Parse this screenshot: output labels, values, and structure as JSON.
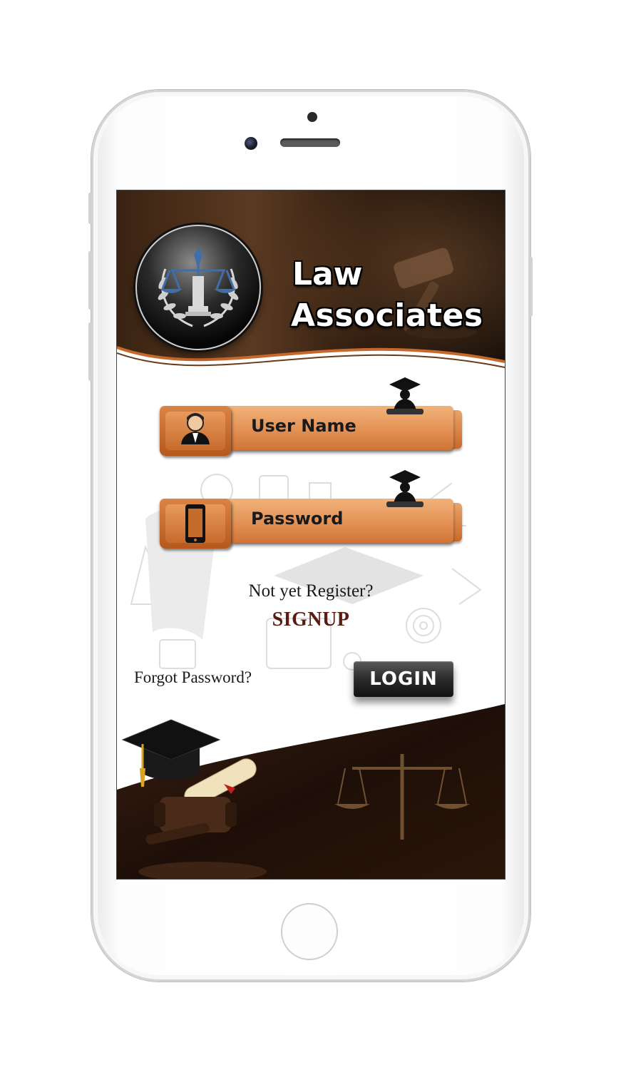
{
  "app": {
    "brand_line1": "Law",
    "brand_line2": "Associates"
  },
  "form": {
    "username_label": "User Name",
    "password_label": "Password",
    "register_prompt": "Not yet Register?",
    "signup_label": "SIGNUP",
    "forgot_label": "Forgot Password?",
    "login_label": "LOGIN"
  },
  "colors": {
    "field_orange": "#e59458",
    "signup_maroon": "#5a1c12",
    "header_brown": "#3a2312"
  },
  "icons": [
    "scales-logo-icon",
    "gavel-icon",
    "user-avatar-icon",
    "mobile-phone-icon",
    "graduate-icon",
    "mortarboard-icon",
    "diploma-icon",
    "scales-icon"
  ]
}
